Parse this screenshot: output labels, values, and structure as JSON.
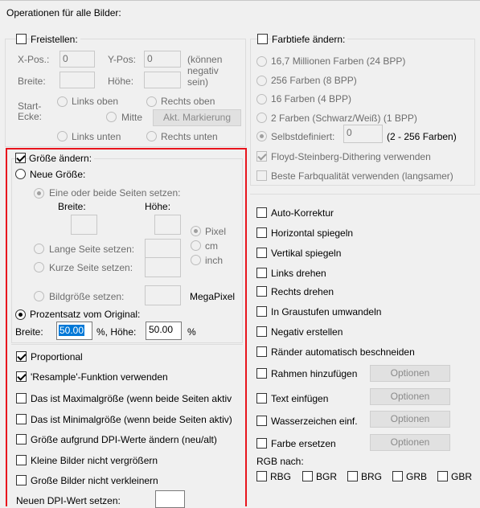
{
  "title": "Operationen für alle Bilder:",
  "crop": {
    "label": "Freistellen:",
    "xpos_label": "X-Pos.:",
    "xpos_value": "0",
    "ypos_label": "Y-Pos:",
    "ypos_value": "0",
    "negative_note_1": "(können",
    "negative_note_2": "negativ",
    "negative_note_3": "sein)",
    "width_label": "Breite:",
    "height_label": "Höhe:",
    "start_label_1": "Start-",
    "start_label_2": "Ecke:",
    "top_left": "Links oben",
    "top_right": "Rechts oben",
    "center": "Mitte",
    "current_mark_button": "Akt. Markierung",
    "bottom_left": "Links unten",
    "bottom_right": "Rechts unten"
  },
  "resize": {
    "label": "Größe ändern:",
    "new_size": "Neue Größe:",
    "set_sides": "Eine oder beide Seiten setzen:",
    "width_label": "Breite:",
    "height_label": "Höhe:",
    "pixel": "Pixel",
    "cm": "cm",
    "inch": "inch",
    "long_side": "Lange Seite setzen:",
    "short_side": "Kurze Seite setzen:",
    "image_size": "Bildgröße setzen:",
    "megapixel": "MegaPixel",
    "percent": "Prozentsatz vom Original:",
    "pct_width_label": "Breite:",
    "pct_width_value": "50.00",
    "pct_sep": "%,  Höhe:",
    "pct_height_value": "50.00",
    "pct_unit": "%",
    "proportional": "Proportional",
    "resample": "'Resample'-Funktion verwenden",
    "max_size": "Das ist Maximalgröße (wenn beide Seiten aktiv",
    "min_size": "Das ist Minimalgröße (wenn beide Seiten aktiv)",
    "dpi_resize": "Größe aufgrund DPI-Werte ändern (neu/alt)",
    "no_enlarge": "Kleine Bilder nicht vergrößern",
    "no_shrink": "Große Bilder nicht verkleinern",
    "dpi_set": "Neuen DPI-Wert setzen:"
  },
  "color_depth": {
    "label": "Farbtiefe ändern:",
    "options": [
      "16,7 Millionen Farben (24 BPP)",
      "256 Farben (8 BPP)",
      "16 Farben (4 BPP)",
      "2 Farben (Schwarz/Weiß) (1 BPP)"
    ],
    "custom": "Selbstdefiniert:",
    "custom_value": "0",
    "custom_range": "(2 - 256 Farben)",
    "dithering": "Floyd-Steinberg-Dithering verwenden",
    "best_quality": "Beste Farbqualität verwenden (langsamer)"
  },
  "operations": {
    "items": [
      "Auto-Korrektur",
      "Horizontal spiegeln",
      "Vertikal spiegeln",
      "Links drehen",
      "Rechts drehen",
      "In Graustufen umwandeln",
      "Negativ erstellen",
      "Ränder automatisch beschneiden"
    ],
    "frame": "Rahmen hinzufügen",
    "text": "Text einfügen",
    "watermark": "Wasserzeichen einf.",
    "replace_color": "Farbe ersetzen",
    "options_label": "Optionen",
    "rgb_label": "RGB nach:",
    "rgb_options": [
      "RBG",
      "BGR",
      "BRG",
      "GRB",
      "GBR"
    ]
  },
  "colors": {
    "highlight_box": "#e8141d",
    "selection": "#0078d7"
  }
}
